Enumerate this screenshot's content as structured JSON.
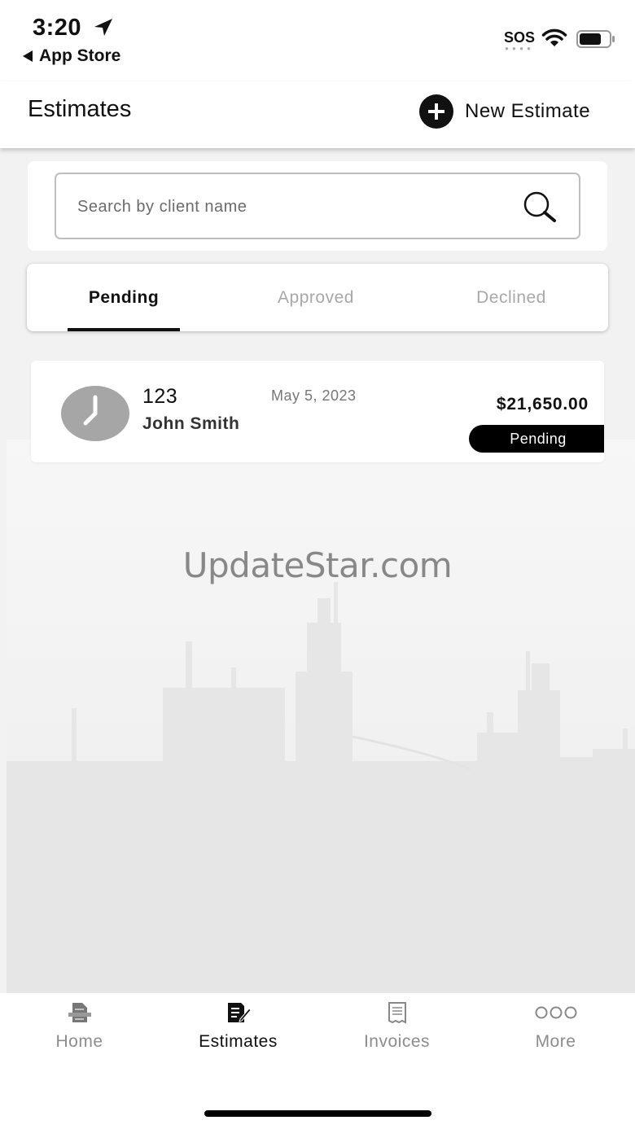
{
  "status_bar": {
    "time": "3:20",
    "back_app": "App Store",
    "sos": "SOS"
  },
  "header": {
    "title": "Estimates",
    "new_estimate_label": "New Estimate"
  },
  "search": {
    "placeholder": "Search by client name",
    "value": ""
  },
  "tabs": [
    {
      "label": "Pending",
      "active": true
    },
    {
      "label": "Approved",
      "active": false
    },
    {
      "label": "Declined",
      "active": false
    }
  ],
  "estimates": [
    {
      "number": "123",
      "client": "John Smith",
      "date": "May 5, 2023",
      "amount": "$21,650.00",
      "status": "Pending"
    }
  ],
  "watermark": "UpdateStar.com",
  "bottom_nav": [
    {
      "label": "Home",
      "icon": "home-document-icon",
      "active": false
    },
    {
      "label": "Estimates",
      "icon": "estimate-edit-icon",
      "active": true
    },
    {
      "label": "Invoices",
      "icon": "invoice-icon",
      "active": false
    },
    {
      "label": "More",
      "icon": "more-dots-icon",
      "active": false
    }
  ],
  "colors": {
    "background": "#f2f2f2",
    "accent": "#111111",
    "inactive": "#a8a8a8",
    "avatar": "#a6a6a6"
  }
}
